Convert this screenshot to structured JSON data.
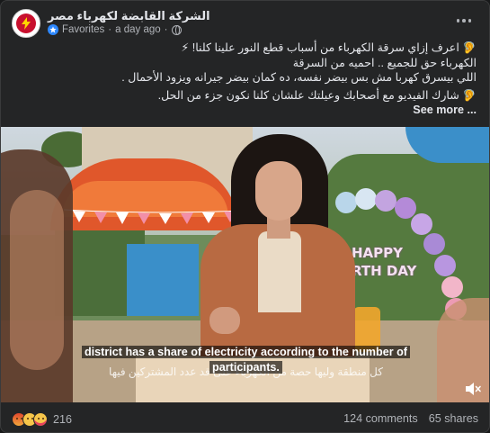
{
  "header": {
    "page_name": "الشركة القابضة لكهرباء مصر",
    "favorites_label": "Favorites",
    "separator": "·",
    "timestamp": "a day ago",
    "separator2": "·"
  },
  "caption": {
    "line1": "🦻 اعرف إزاي سرقة الكهرباء من أسباب قطع النور علينا كلنا! ⚡",
    "line2": "الكهرباء حق للجميع .. احميه من السرقة",
    "line3": "اللي بيسرق كهربا مش بس بيضر نفسه، ده كمان بيضر جيرانه ويزود الأحمال .",
    "line4": "🦻 شارك الفيديو مع أصحابك وعيلتك علشان كلنا نكون جزء من الحل.",
    "ellipsis": "...",
    "see_more": "See more"
  },
  "video": {
    "subtitle_en_line1": "district has a share of electricity according to the number of",
    "subtitle_en_line2": "participants.",
    "subtitle_ar": "كل منطقة وليها حصة من الكهرباء على قد عدد المشتركين فيها",
    "sign_line1": "HAPPY",
    "sign_line2": "RTH DAY"
  },
  "footer": {
    "reaction_count": "216",
    "comments": "124 comments",
    "shares": "65 shares"
  },
  "colors": {
    "background": "#242526",
    "text": "#e4e6eb",
    "muted": "#b0b3b8",
    "brand_red": "#c8102e",
    "favorites_blue": "#2d88ff"
  },
  "icons": [
    "lightning-bolt-icon",
    "favorites-icon",
    "globe-icon",
    "more-options-icon",
    "mute-icon",
    "angry-reaction-icon",
    "haha-reaction-icon",
    "care-reaction-icon"
  ]
}
